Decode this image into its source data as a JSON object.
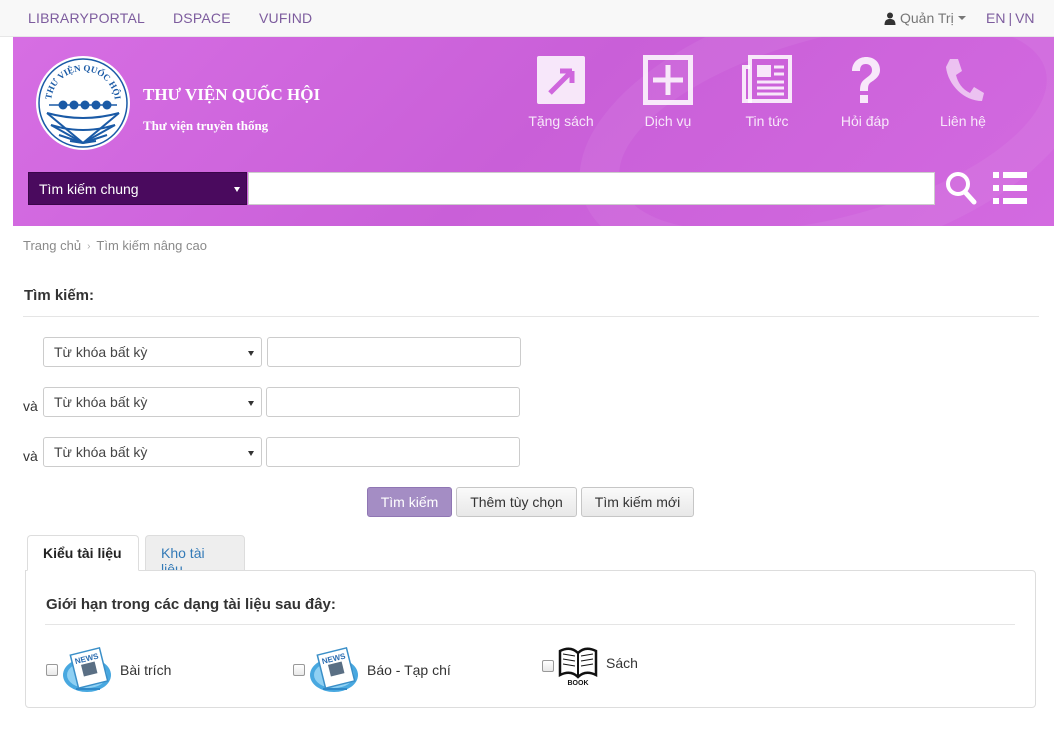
{
  "topnav": {
    "links": [
      "LIBRARYPORTAL",
      "DSPACE",
      "VUFIND"
    ],
    "user": "Quản Trị",
    "lang_en": "EN",
    "lang_sep": "|",
    "lang_vn": "VN"
  },
  "header": {
    "site_name": "THƯ VIỆN QUỐC HỘI",
    "site_sub": "Thư viện truyền thống",
    "logo_text": "THƯ VIỆN QUỐC HỘI",
    "nav": [
      {
        "label": "Tặng sách",
        "icon": "gift-book-icon"
      },
      {
        "label": "Dịch vụ",
        "icon": "plus-box-icon"
      },
      {
        "label": "Tin tức",
        "icon": "news-icon"
      },
      {
        "label": "Hỏi đáp",
        "icon": "question-icon"
      },
      {
        "label": "Liên hệ",
        "icon": "phone-icon"
      }
    ],
    "search_type": "Tìm kiếm chung",
    "search_value": ""
  },
  "breadcrumb": {
    "home": "Trang chủ",
    "current": "Tìm kiếm nâng cao"
  },
  "search_form": {
    "title": "Tìm kiếm:",
    "rows": [
      {
        "conj": "",
        "field": "Từ khóa bất kỳ",
        "value": ""
      },
      {
        "conj": "và",
        "field": "Từ khóa bất kỳ",
        "value": ""
      },
      {
        "conj": "và",
        "field": "Từ khóa bất kỳ",
        "value": ""
      }
    ],
    "buttons": {
      "search": "Tìm kiếm",
      "more_options": "Thêm tùy chọn",
      "new_search": "Tìm kiếm mới"
    }
  },
  "tabs": {
    "doc_type": "Kiểu tài liệu",
    "repository": "Kho tài liệu"
  },
  "doc_types": {
    "title": "Giới hạn trong các dạng tài liệu sau đây:",
    "items": [
      {
        "label": "Bài trích",
        "icon": "news-paper-icon",
        "checked": false
      },
      {
        "label": "Báo - Tạp chí",
        "icon": "news-paper-icon",
        "checked": false
      },
      {
        "label": "Sách",
        "icon": "book-icon",
        "checked": false,
        "icon_text": "BOOK"
      }
    ]
  },
  "colors": {
    "header_bg": "#d66ee3",
    "search_select_bg": "#4a0a5e",
    "link": "#7d5c9e",
    "primary_button": "#a48dc4"
  }
}
